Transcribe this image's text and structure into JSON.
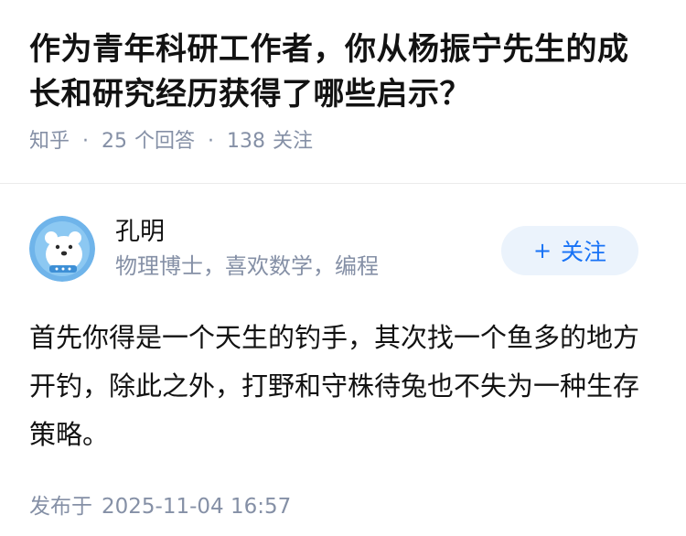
{
  "question": {
    "title": "作为青年科研工作者，你从杨振宁先生的成长和研究经历获得了哪些启示？",
    "source": "知乎",
    "answer_count": "25",
    "answer_label": "个回答",
    "follow_count": "138",
    "follow_label": "关注"
  },
  "answer": {
    "author_name": "孔明",
    "author_bio": "物理博士，喜欢数学，编程",
    "follow_button_label": "关注",
    "content": "首先你得是一个天生的钓手，其次找一个鱼多的地方开钓，除此之外，打野和守株待兔也不失为一种生存策略。",
    "published_label": "发布于",
    "published_time": "2025-11-04 16:57"
  },
  "colors": {
    "accent": "#1772f6",
    "button_bg": "#ebf3fc",
    "meta_text": "#8590a6"
  }
}
